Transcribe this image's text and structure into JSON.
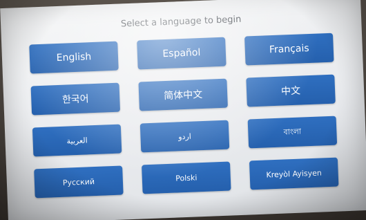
{
  "prompt": "Select a language to begin",
  "languages": [
    {
      "label": "English"
    },
    {
      "label": "Español"
    },
    {
      "label": "Français"
    },
    {
      "label": "한국어"
    },
    {
      "label": "简体中文"
    },
    {
      "label": "中文"
    },
    {
      "label": "العربية"
    },
    {
      "label": "اردو"
    },
    {
      "label": "বাংলা"
    },
    {
      "label": "Русский"
    },
    {
      "label": "Polski"
    },
    {
      "label": "Kreyòl Ayisyen"
    }
  ]
}
